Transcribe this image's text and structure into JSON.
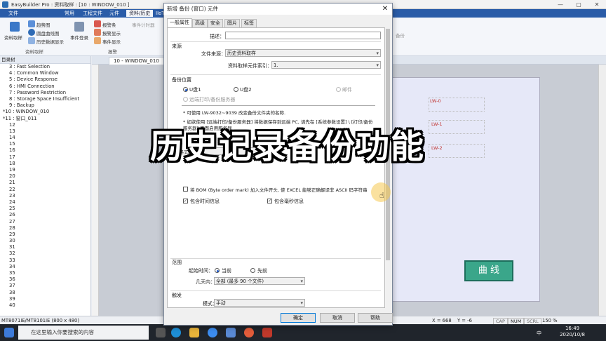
{
  "app": {
    "title": "EasyBuilder Pro : 资料取样 : [10 : WINDOW_010 ]",
    "controls": [
      "—",
      "▢",
      "✕"
    ]
  },
  "menu": [
    "文件",
    "常用",
    "工程文件",
    "元件",
    "资料/历史",
    "IIoT"
  ],
  "menu_active": "资料/历史",
  "ribbon": {
    "sampling_label": "资料取样",
    "trend_label": "趋势图",
    "pie_label": "圆盘曲线图",
    "history_label": "历史数据显示",
    "event_log_label": "事件登录",
    "alarm_bar_label": "报警条",
    "alarm_display_label": "报警显示",
    "event_display_label": "事件显示",
    "event_time_bar_label": "事件计时器",
    "group_sampling": "资料取样",
    "group_alarm": "报警",
    "right_partial": "备份"
  },
  "tree": {
    "header": "目录树",
    "rows": [
      "3 : Fast Selection",
      "4 : Common Window",
      "5 : Device Response",
      "6 : HMI Connection",
      "7 : Password Restriction",
      "8 : Storage Space Insufficient",
      "9 : Backup",
      "*10 : WINDOW_010",
      "*11 : 窗口_011",
      "12",
      "13",
      "14",
      "15",
      "16",
      "17",
      "18",
      "19",
      "20",
      "21",
      "22",
      "23",
      "24",
      "25",
      "26",
      "27",
      "28",
      "29",
      "30",
      "31",
      "32",
      "33",
      "34",
      "35",
      "36",
      "37",
      "38",
      "39",
      "40"
    ]
  },
  "editor": {
    "tab": "10 - WINDOW_010",
    "lw_labels": [
      "LW-0",
      "LW-1",
      "LW-2"
    ],
    "curve_button": "曲 线"
  },
  "status": {
    "model": "MT8071iE/MT8101iE (800 x 480)",
    "x": "X = 668",
    "y": "Y = -6",
    "keys": [
      "CAP",
      "NUM",
      "SCRL"
    ],
    "zoom": "150 %"
  },
  "taskbar": {
    "search_placeholder": "在这里输入你要搜索的内容",
    "time": "16:49",
    "date": "2020/10/8",
    "ime": "中"
  },
  "dialog": {
    "title": "新增 备份 (窗口) 元件",
    "close": "✕",
    "tabs": [
      "一般属性",
      "高级",
      "安全",
      "图片",
      "标签"
    ],
    "active_tab": "一般属性",
    "desc_label": "描述：",
    "desc_value": "",
    "source_section": "来源",
    "file_source_label": "文件来源：",
    "file_source_value": "历史资料取样",
    "sampling_index_label": "资料取样元件索引：",
    "sampling_index_value": "1.",
    "backup_section": "备份位置",
    "locations": [
      "U盘1",
      "U盘2",
      "邮件",
      "远端打印/备份服务器"
    ],
    "selected_location": "U盘1",
    "note1": "* 可使用 LW-9032~9039 改变备份文件夹的名称.",
    "note2": "* 如欲使用 [远端打印/备份服务器] 将数据保存到远端 PC, 请先在 [系统参数设置] \\ [打印/备份",
    "note3": "服务器] 页面启用服务器",
    "format_section": "保",
    "format_label": "格式：",
    "format_value": "S",
    "bom_label": "将 BOM (Byte order mark) 加入文件开头, 使 EXCEL 能够正确解译非 ASCII 码字符串",
    "include_time_label": "包含时间信息",
    "include_ms_label": "包含毫秒信息",
    "range_section": "范围",
    "start_label": "起始时间：",
    "start_options": [
      "当前",
      "先前"
    ],
    "days_label": "几天内：",
    "days_value": "全部 (最多 90 个文件)",
    "trigger_section": "触发",
    "mode_label": "模式：",
    "mode_value": "手动",
    "ok": "确定",
    "cancel": "取消",
    "help": "帮助"
  },
  "overlay_caption": "历史记录备份功能",
  "colors": {
    "menubar": "#2a5ca8",
    "curve_button": "#3aa68a",
    "lw_label": "#c0302c"
  }
}
